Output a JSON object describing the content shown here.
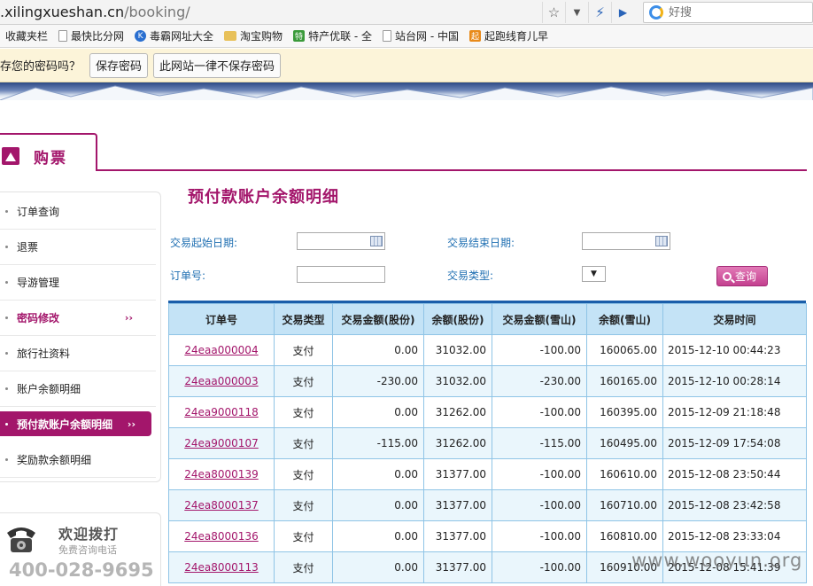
{
  "browser": {
    "url_host": ".xilingxueshan.cn",
    "url_path": "/booking/",
    "search_placeholder": "好搜",
    "bookmarks": [
      "收藏夹栏",
      "最快比分网",
      "毒霸网址大全",
      "淘宝购物",
      "特产优联 - 全",
      "站台网 - 中国",
      "起跑线育儿早"
    ],
    "password_prompt": "存您的密码吗？",
    "save_password": "保存密码",
    "never_save": "此网站一律不保存密码"
  },
  "tab": {
    "label": "购票"
  },
  "sidebar": {
    "items": [
      {
        "label": "订单查询"
      },
      {
        "label": "退票"
      },
      {
        "label": "导游管理"
      },
      {
        "label": "密码修改",
        "arrow": "››"
      },
      {
        "label": "旅行社资料"
      },
      {
        "label": "账户余额明细"
      },
      {
        "label": "预付款账户余额明细",
        "arrow": "››"
      },
      {
        "label": "奖励款余额明细"
      }
    ]
  },
  "hotline": {
    "title": "欢迎拨打",
    "subtitle": "免费咨询电话",
    "number": "400-028-9695"
  },
  "main": {
    "title": "预付款账户余额明细",
    "filters": {
      "start_date_label": "交易起始日期:",
      "end_date_label": "交易结束日期:",
      "order_no_label": "订单号:",
      "type_label": "交易类型:",
      "start_date_value": "",
      "end_date_value": "",
      "order_no_value": "",
      "type_value": "",
      "select_arrow": "▼",
      "query_button": "查询"
    },
    "table": {
      "headers": [
        "订单号",
        "交易类型",
        "交易金额(股份)",
        "余额(股份)",
        "交易金额(雪山)",
        "余额(雪山)",
        "交易时间"
      ],
      "rows": [
        [
          "24eaa000004",
          "支付",
          "0.00",
          "31032.00",
          "-100.00",
          "160065.00",
          "2015-12-10 00:44:23"
        ],
        [
          "24eaa000003",
          "支付",
          "-230.00",
          "31032.00",
          "-230.00",
          "160165.00",
          "2015-12-10 00:28:14"
        ],
        [
          "24ea9000118",
          "支付",
          "0.00",
          "31262.00",
          "-100.00",
          "160395.00",
          "2015-12-09 21:18:48"
        ],
        [
          "24ea9000107",
          "支付",
          "-115.00",
          "31262.00",
          "-115.00",
          "160495.00",
          "2015-12-09 17:54:08"
        ],
        [
          "24ea8000139",
          "支付",
          "0.00",
          "31377.00",
          "-100.00",
          "160610.00",
          "2015-12-08 23:50:44"
        ],
        [
          "24ea8000137",
          "支付",
          "0.00",
          "31377.00",
          "-100.00",
          "160710.00",
          "2015-12-08 23:42:58"
        ],
        [
          "24ea8000136",
          "支付",
          "0.00",
          "31377.00",
          "-100.00",
          "160810.00",
          "2015-12-08 23:33:04"
        ],
        [
          "24ea8000113",
          "支付",
          "0.00",
          "31377.00",
          "-100.00",
          "160910.00",
          "2015-12-08 15:41:39"
        ]
      ]
    }
  },
  "watermark": "www.wooyun.org",
  "colors": {
    "accent": "#a3166b",
    "table_header": "#c4e3f6",
    "table_border": "#8fc4e6",
    "label_blue": "#1f6fb2"
  }
}
